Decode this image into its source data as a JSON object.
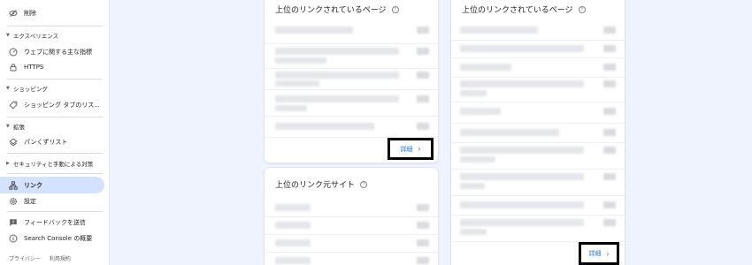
{
  "sidebar": {
    "top_item": "削除",
    "sections": [
      {
        "title": "エクスペリエンス",
        "items": [
          "ウェブに関する主な指標",
          "HTTPS"
        ]
      },
      {
        "title": "ショッピング",
        "items": [
          "ショッピング タブのリス..."
        ]
      },
      {
        "title": "拡張",
        "items": [
          "パンくずリスト"
        ]
      },
      {
        "title": "セキュリティと手動による対策",
        "items": []
      }
    ],
    "links_label": "リンク",
    "settings_label": "設定",
    "feedback_label": "フィードバックを送信",
    "about_label": "Search Console の概要",
    "footer": {
      "privacy": "プライバシー",
      "terms": "利用規約"
    }
  },
  "cards": {
    "top_linked_pages_left": {
      "title": "上位のリンクされているページ",
      "detail_label": "詳細"
    },
    "top_linking_sites": {
      "title": "上位のリンク元サイト"
    },
    "top_linked_pages_right": {
      "title": "上位のリンクされているページ",
      "detail_label": "詳細"
    }
  },
  "colors": {
    "accent": "#1a73e8",
    "active_bg": "#d3e3fd",
    "page_bg": "#eef3fd"
  }
}
